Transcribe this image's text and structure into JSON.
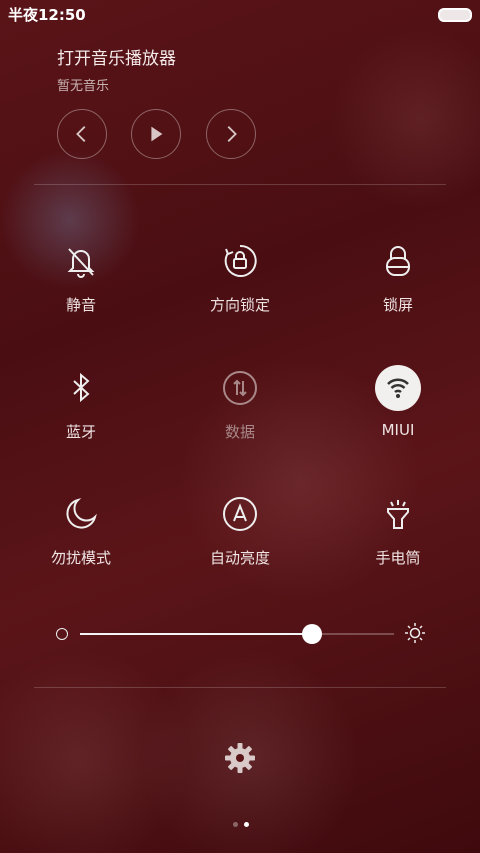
{
  "status_bar": {
    "time": "半夜12:50"
  },
  "music": {
    "title": "打开音乐播放器",
    "subtitle": "暂无音乐",
    "controls": [
      "chevron-left-icon",
      "play-icon",
      "chevron-right-icon"
    ]
  },
  "toggles": [
    {
      "label": "静音",
      "icon": "bell-off-icon",
      "state": "off"
    },
    {
      "label": "方向锁定",
      "icon": "rotation-lock-icon",
      "state": "off"
    },
    {
      "label": "锁屏",
      "icon": "lock-icon",
      "state": "off"
    },
    {
      "label": "蓝牙",
      "icon": "bluetooth-icon",
      "state": "off"
    },
    {
      "label": "数据",
      "icon": "mobile-data-icon",
      "state": "disabled"
    },
    {
      "label": "MIUI",
      "icon": "wifi-icon",
      "state": "on"
    },
    {
      "label": "勿扰模式",
      "icon": "moon-icon",
      "state": "off"
    },
    {
      "label": "自动亮度",
      "icon": "auto-brightness-icon",
      "state": "off"
    },
    {
      "label": "手电筒",
      "icon": "flashlight-icon",
      "state": "off"
    }
  ],
  "brightness": {
    "level": 0.74
  },
  "pager": {
    "count": 2,
    "active": 1
  },
  "colors": {
    "background": "#4a0e12",
    "active_toggle": "#f2efef",
    "text": "#efe3e3",
    "disabled_text": "#a88888"
  }
}
